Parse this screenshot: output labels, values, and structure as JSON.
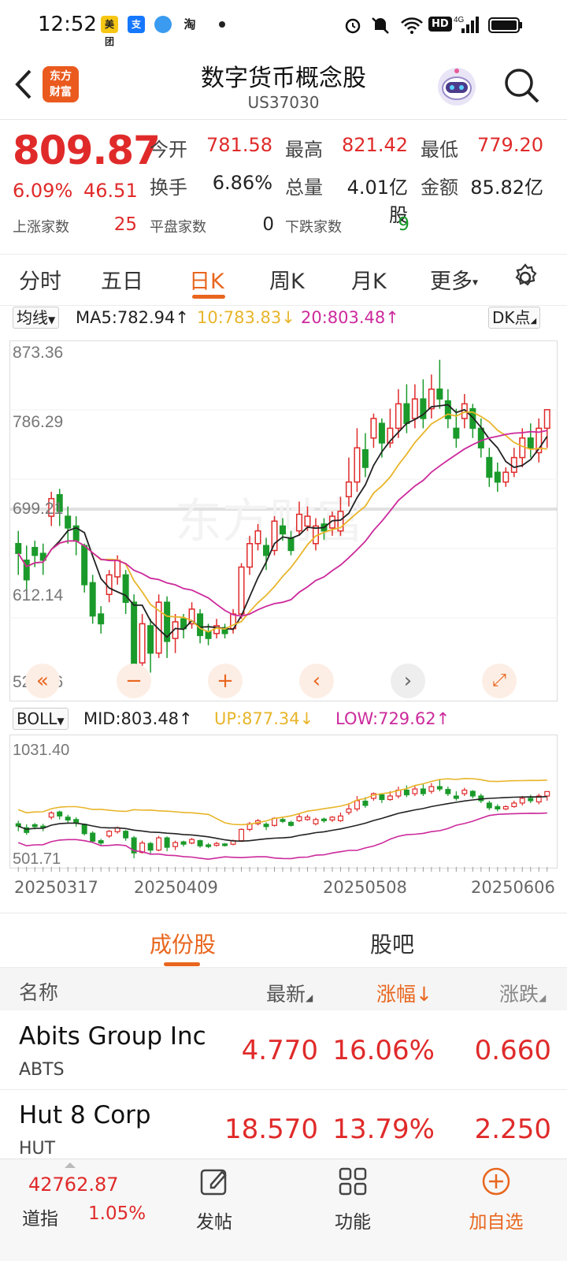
{
  "status": {
    "time": "12:52",
    "apps": [
      "美团",
      "支",
      "",
      "淘"
    ],
    "network": "4G",
    "hd": "HD"
  },
  "header": {
    "title": "数字货币概念股",
    "code": "US37030"
  },
  "quote": {
    "price": "809.87",
    "pct": "6.09%",
    "change": "46.51",
    "open_label": "今开",
    "open": "781.58",
    "high_label": "最高",
    "high": "821.42",
    "low_label": "最低",
    "low": "779.20",
    "turnover_label": "换手",
    "turnover": "6.86%",
    "volume_label": "总量",
    "volume": "4.01亿股",
    "amount_label": "金额",
    "amount": "85.82亿",
    "up_label": "上涨家数",
    "up": "25",
    "flat_label": "平盘家数",
    "flat": "0",
    "down_label": "下跌家数",
    "down": "9"
  },
  "tabs": [
    "分时",
    "五日",
    "日K",
    "周K",
    "月K",
    "更多"
  ],
  "active_tab": "日K",
  "ma": {
    "select": "均线",
    "ma5": "MA5:782.94",
    "ma10": "10:783.83",
    "ma20": "20:803.48",
    "dk": "DK点"
  },
  "kchart": {
    "ticks": [
      "873.36",
      "786.29",
      "699.21",
      "612.14",
      "525.06"
    ],
    "watermark": "东方财富"
  },
  "boll": {
    "select": "BOLL",
    "mid": "MID:803.48",
    "up": "UP:877.34",
    "low": "LOW:729.62",
    "ticks": [
      "1031.40",
      "501.71"
    ]
  },
  "dates": [
    "20250317",
    "20250409",
    "20250508",
    "20250606"
  ],
  "lower_tabs": [
    "成份股",
    "股吧"
  ],
  "table": {
    "headers": [
      "名称",
      "最新",
      "涨幅",
      "涨跌"
    ],
    "rows": [
      {
        "name": "Abits Group Inc",
        "code": "ABTS",
        "last": "4.770",
        "pct": "16.06%",
        "chg": "0.660"
      },
      {
        "name": "Hut 8 Corp",
        "code": "HUT",
        "last": "18.570",
        "pct": "13.79%",
        "chg": "2.250"
      }
    ]
  },
  "bottom": {
    "index_value": "42762.87",
    "index_name": "道指",
    "index_pct": "1.05%",
    "post": "发帖",
    "func": "功能",
    "add": "加自选"
  },
  "colors": {
    "up": "#e02a2a",
    "down": "#1a9a2a",
    "accent": "#e8661e",
    "ma5": "#222222",
    "ma10": "#e8b52a",
    "ma20": "#cc2a9c"
  },
  "candles": [
    [
      672,
      662,
      685,
      640
    ],
    [
      655,
      635,
      670,
      625
    ],
    [
      668,
      660,
      675,
      648
    ],
    [
      662,
      655,
      672,
      640
    ],
    [
      700,
      718,
      725,
      690
    ],
    [
      722,
      705,
      728,
      690
    ],
    [
      700,
      688,
      710,
      672
    ],
    [
      690,
      675,
      700,
      660
    ],
    [
      670,
      630,
      672,
      622
    ],
    [
      632,
      598,
      640,
      590
    ],
    [
      600,
      590,
      608,
      580
    ],
    [
      620,
      640,
      645,
      612
    ],
    [
      638,
      655,
      660,
      630
    ],
    [
      640,
      612,
      645,
      600
    ],
    [
      612,
      548,
      620,
      525
    ],
    [
      550,
      590,
      600,
      545
    ],
    [
      588,
      560,
      595,
      540
    ],
    [
      560,
      612,
      620,
      555
    ],
    [
      612,
      572,
      618,
      555
    ],
    [
      575,
      592,
      600,
      560
    ],
    [
      595,
      585,
      600,
      575
    ],
    [
      590,
      605,
      612,
      585
    ],
    [
      600,
      578,
      605,
      570
    ],
    [
      582,
      575,
      590,
      568
    ],
    [
      580,
      588,
      595,
      575
    ],
    [
      586,
      580,
      590,
      575
    ],
    [
      585,
      600,
      605,
      580
    ],
    [
      600,
      648,
      652,
      595
    ],
    [
      648,
      672,
      680,
      640
    ],
    [
      672,
      685,
      692,
      665
    ],
    [
      670,
      660,
      678,
      645
    ],
    [
      665,
      695,
      700,
      660
    ],
    [
      690,
      682,
      698,
      675
    ],
    [
      678,
      665,
      685,
      660
    ],
    [
      685,
      702,
      715,
      680
    ],
    [
      690,
      700,
      710,
      685
    ],
    [
      672,
      690,
      698,
      665
    ],
    [
      692,
      685,
      698,
      676
    ],
    [
      688,
      700,
      705,
      680
    ],
    [
      685,
      705,
      720,
      680
    ],
    [
      720,
      735,
      760,
      710
    ],
    [
      735,
      770,
      790,
      725
    ],
    [
      768,
      750,
      785,
      740
    ],
    [
      780,
      800,
      805,
      770
    ],
    [
      795,
      775,
      800,
      760
    ],
    [
      775,
      790,
      810,
      770
    ],
    [
      790,
      815,
      830,
      780
    ],
    [
      815,
      795,
      835,
      785
    ],
    [
      800,
      820,
      835,
      790
    ],
    [
      820,
      800,
      840,
      790
    ],
    [
      810,
      830,
      845,
      800
    ],
    [
      830,
      820,
      860,
      810
    ],
    [
      818,
      800,
      830,
      790
    ],
    [
      790,
      780,
      810,
      770
    ],
    [
      800,
      815,
      825,
      790
    ],
    [
      810,
      790,
      815,
      780
    ],
    [
      790,
      770,
      800,
      760
    ],
    [
      760,
      740,
      770,
      730
    ],
    [
      745,
      735,
      755,
      725
    ],
    [
      735,
      745,
      750,
      730
    ],
    [
      745,
      760,
      770,
      740
    ],
    [
      760,
      780,
      790,
      750
    ],
    [
      780,
      770,
      795,
      760
    ],
    [
      765,
      790,
      800,
      755
    ],
    [
      790,
      809,
      805,
      770
    ]
  ]
}
